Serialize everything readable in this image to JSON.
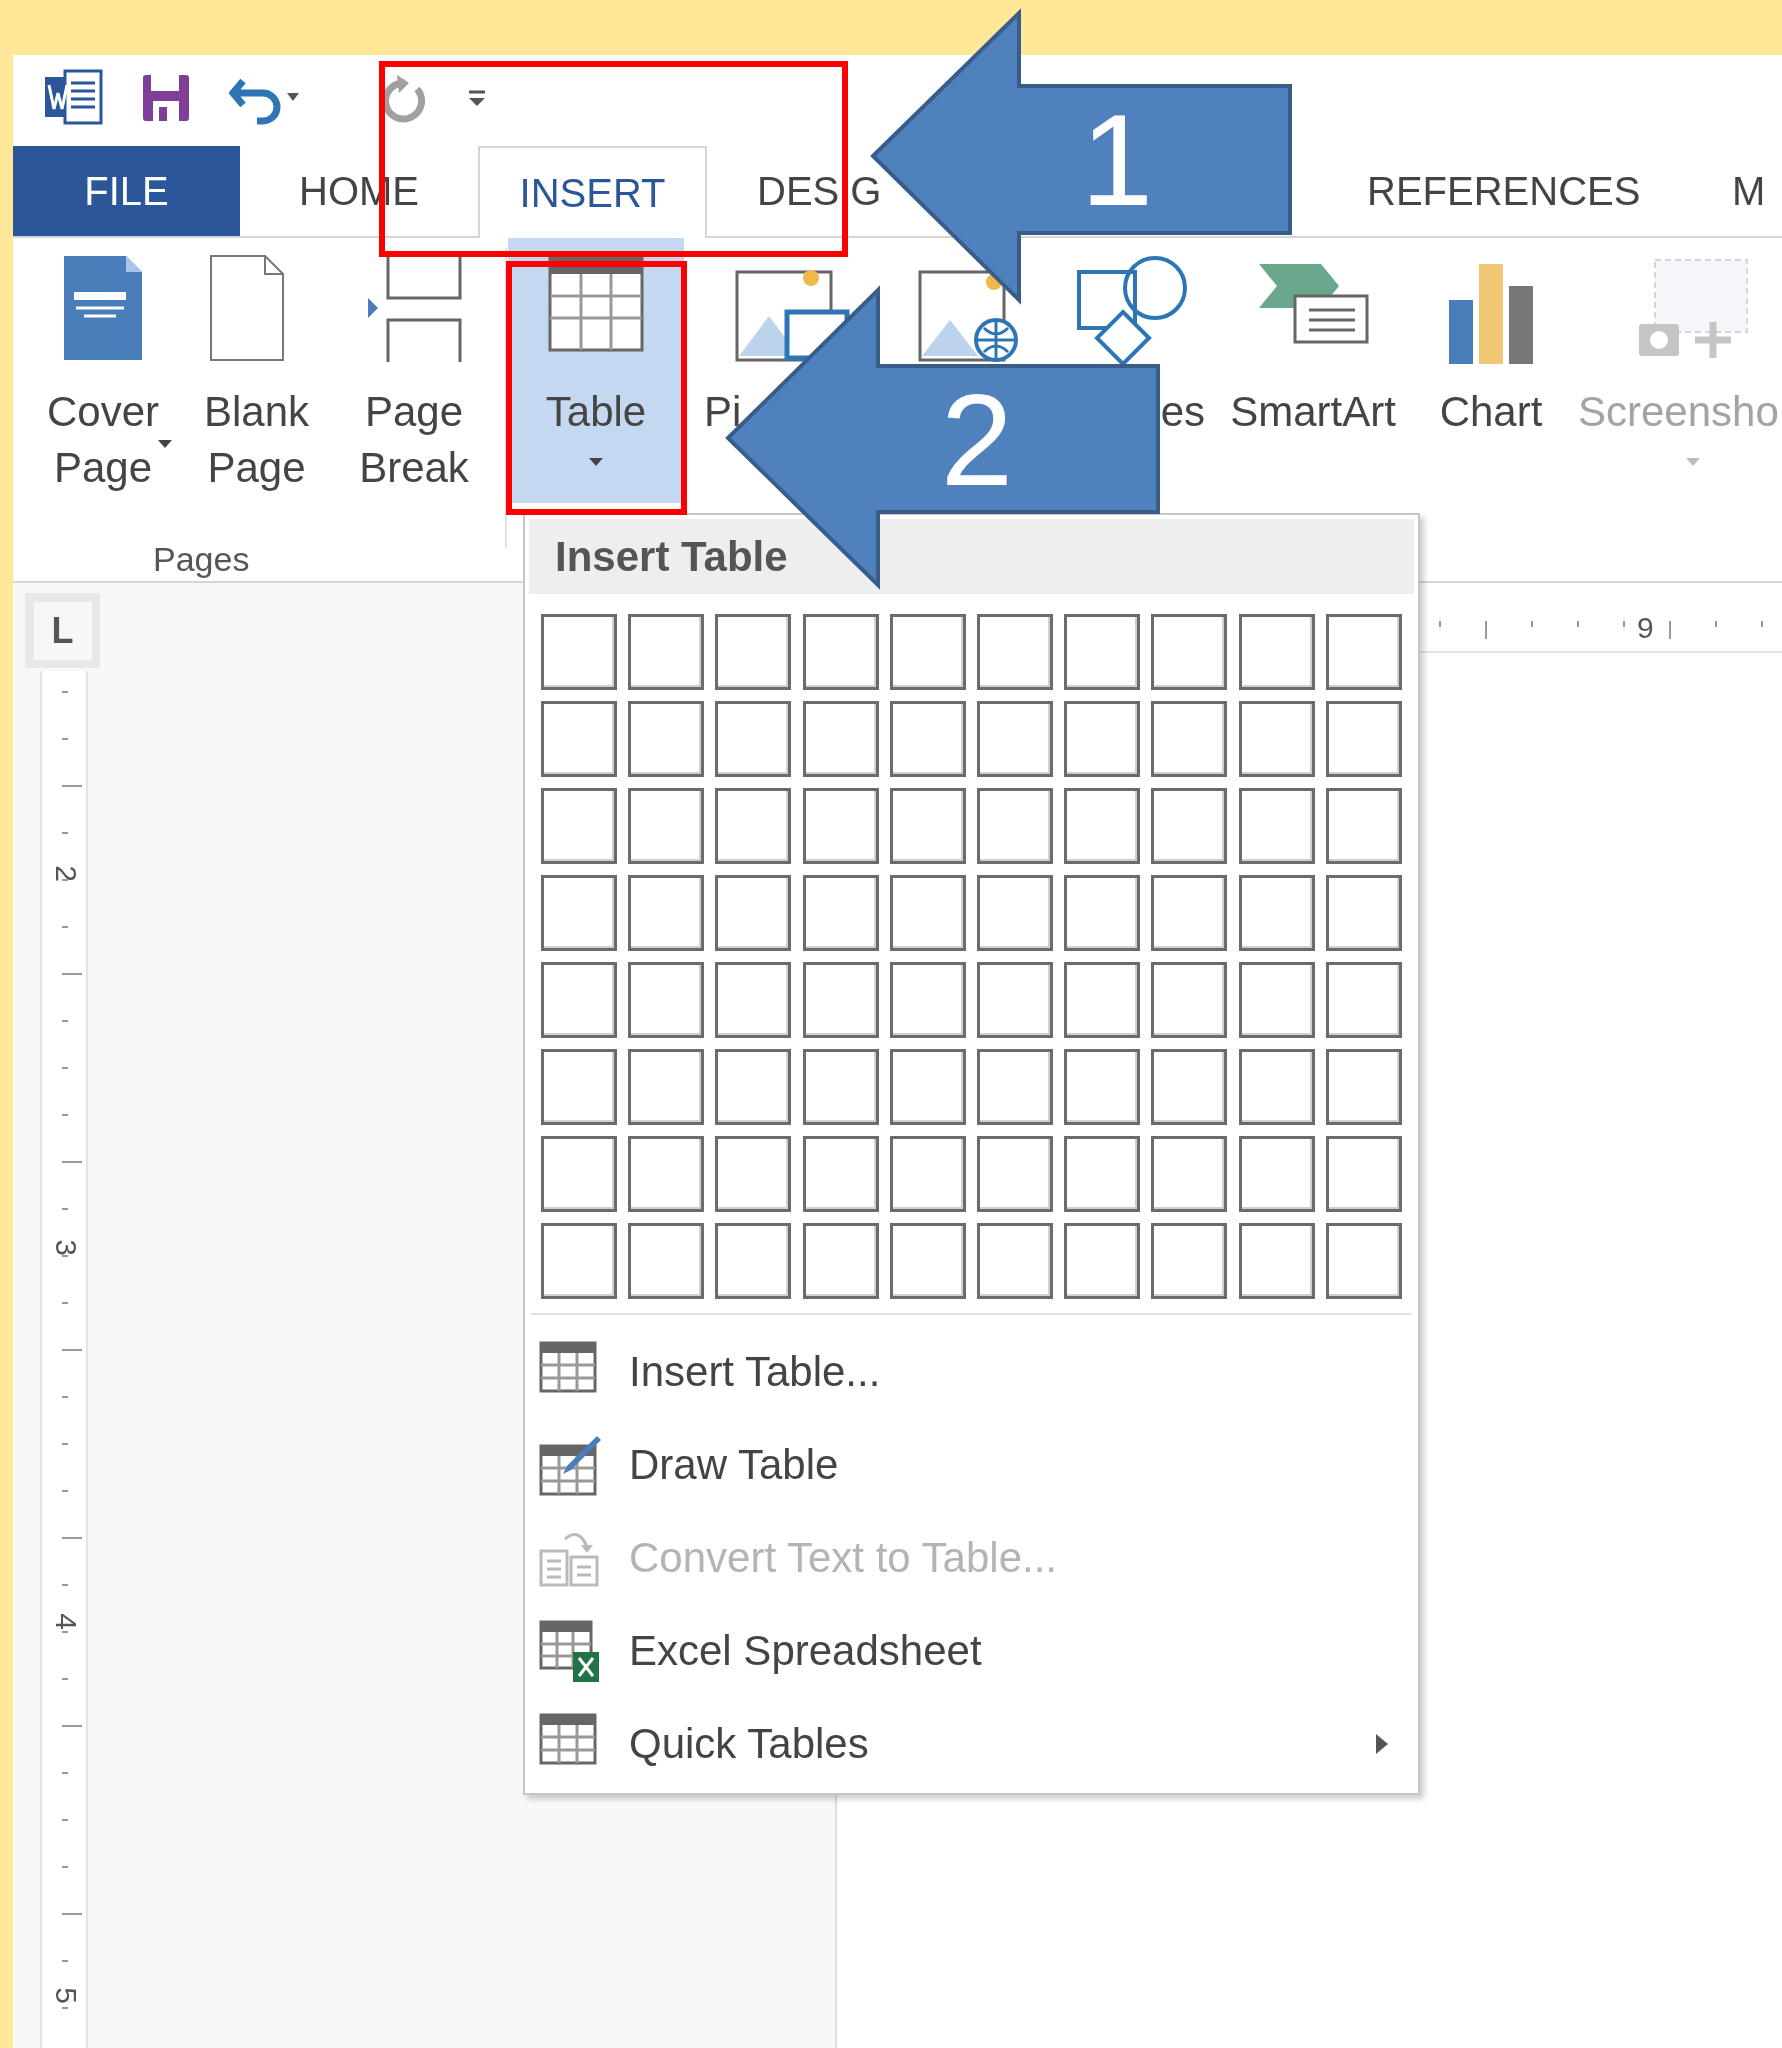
{
  "quick_access": [
    {
      "kind": "word"
    },
    {
      "kind": "save"
    },
    {
      "kind": "undo"
    },
    {
      "kind": "redo"
    },
    {
      "kind": "customize"
    }
  ],
  "tabs": [
    {
      "label": "FILE",
      "kind": "file",
      "selected": false
    },
    {
      "label": "HOME",
      "kind": "tab",
      "selected": false
    },
    {
      "label": "INSERT",
      "kind": "tab",
      "selected": true
    },
    {
      "label": "DESIG",
      "kind": "tab",
      "selected": false
    },
    {
      "label": "REFERENCES",
      "kind": "tab",
      "selected": false
    },
    {
      "label": "M",
      "kind": "tab",
      "selected": false
    }
  ],
  "ribbon": {
    "buttons": [
      {
        "kind": "cover_page",
        "lines": [
          "Cover",
          "Page"
        ],
        "dropdown": true,
        "selected": false,
        "disabled": false
      },
      {
        "kind": "blank_page",
        "lines": [
          "Blank",
          "Page"
        ],
        "selected": false,
        "disabled": false
      },
      {
        "kind": "page_break",
        "lines": [
          "Page",
          "Break"
        ],
        "selected": false,
        "disabled": false
      },
      {
        "kind": "table",
        "lines": [
          "Table"
        ],
        "dropdown": true,
        "selected": true,
        "disabled": false
      },
      {
        "kind": "pictures",
        "lines": [
          "Pi"
        ],
        "selected": false,
        "disabled": false
      },
      {
        "kind": "online_pictures",
        "selected": false,
        "disabled": false
      },
      {
        "kind": "shapes",
        "lines": [
          "es"
        ],
        "selected": false,
        "disabled": false
      },
      {
        "kind": "smartart",
        "lines": [
          "SmartArt"
        ],
        "selected": false,
        "disabled": false
      },
      {
        "kind": "chart",
        "lines": [
          "Chart"
        ],
        "selected": false,
        "disabled": false
      },
      {
        "kind": "screenshot",
        "lines": [
          "Screensho"
        ],
        "dropdown": true,
        "selected": false,
        "disabled": true
      }
    ],
    "group_label": "Pages"
  },
  "table_menu": {
    "title": "Insert Table",
    "items": [
      {
        "kind": "insert",
        "label": "Insert Table...",
        "disabled": false
      },
      {
        "kind": "draw",
        "label": "Draw Table",
        "disabled": false
      },
      {
        "kind": "convert",
        "label": "Convert Text to Table...",
        "disabled": true
      },
      {
        "kind": "excel",
        "label": "Excel Spreadsheet",
        "disabled": false
      },
      {
        "kind": "quick",
        "label": "Quick Tables",
        "disabled": false,
        "submenu": true
      }
    ]
  },
  "ruler": {
    "tab_stop": "L",
    "vertical_numbers": [
      "2",
      "3",
      "4",
      "5"
    ],
    "horizontal_number": "9"
  },
  "annotations": [
    {
      "label": "1"
    },
    {
      "label": "2"
    }
  ]
}
